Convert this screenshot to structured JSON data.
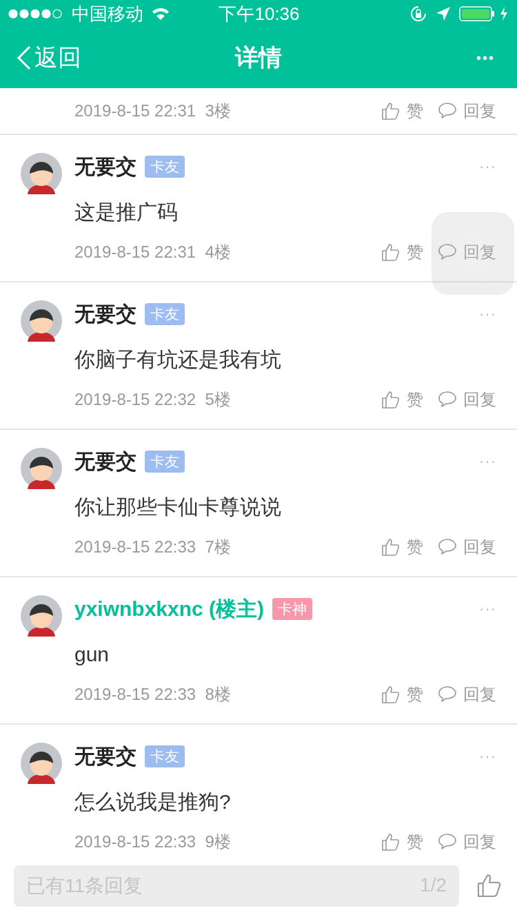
{
  "status_bar": {
    "carrier": "中国移动",
    "time": "下午10:36"
  },
  "nav": {
    "back": "返回",
    "title": "详情",
    "more": "•••"
  },
  "partial_comment": {
    "time": "2019-8-15 22:31",
    "floor": "3楼",
    "like": "赞",
    "reply": "回复"
  },
  "comments": [
    {
      "author": "无要交",
      "highlight": false,
      "badge": "卡友",
      "color": "#9dbcf0",
      "body": "这是推广码",
      "time": "2019-8-15 22:31",
      "floor": "4楼",
      "like": "赞",
      "reply": "回复",
      "more": "···"
    },
    {
      "author": "无要交",
      "highlight": false,
      "badge": "卡友",
      "color": "#9dbcf0",
      "body": "你脑子有坑还是我有坑",
      "time": "2019-8-15 22:32",
      "floor": "5楼",
      "like": "赞",
      "reply": "回复",
      "more": "···"
    },
    {
      "author": "无要交",
      "highlight": false,
      "badge": "卡友",
      "color": "#9dbcf0",
      "body": "你让那些卡仙卡尊说说",
      "time": "2019-8-15 22:33",
      "floor": "7楼",
      "like": "赞",
      "reply": "回复",
      "more": "···"
    },
    {
      "author": "yxiwnbxkxnc (楼主)",
      "highlight": true,
      "badge": "卡神",
      "color": "#f797a9",
      "body": "gun",
      "time": "2019-8-15 22:33",
      "floor": "8楼",
      "like": "赞",
      "reply": "回复",
      "more": "···"
    },
    {
      "author": "无要交",
      "highlight": false,
      "badge": "卡友",
      "color": "#9dbcf0",
      "body": "怎么说我是推狗?",
      "time": "2019-8-15 22:33",
      "floor": "9楼",
      "like": "赞",
      "reply": "回复",
      "more": "···"
    }
  ],
  "reply_bar": {
    "placeholder": "已有11条回复",
    "page": "1/2"
  }
}
